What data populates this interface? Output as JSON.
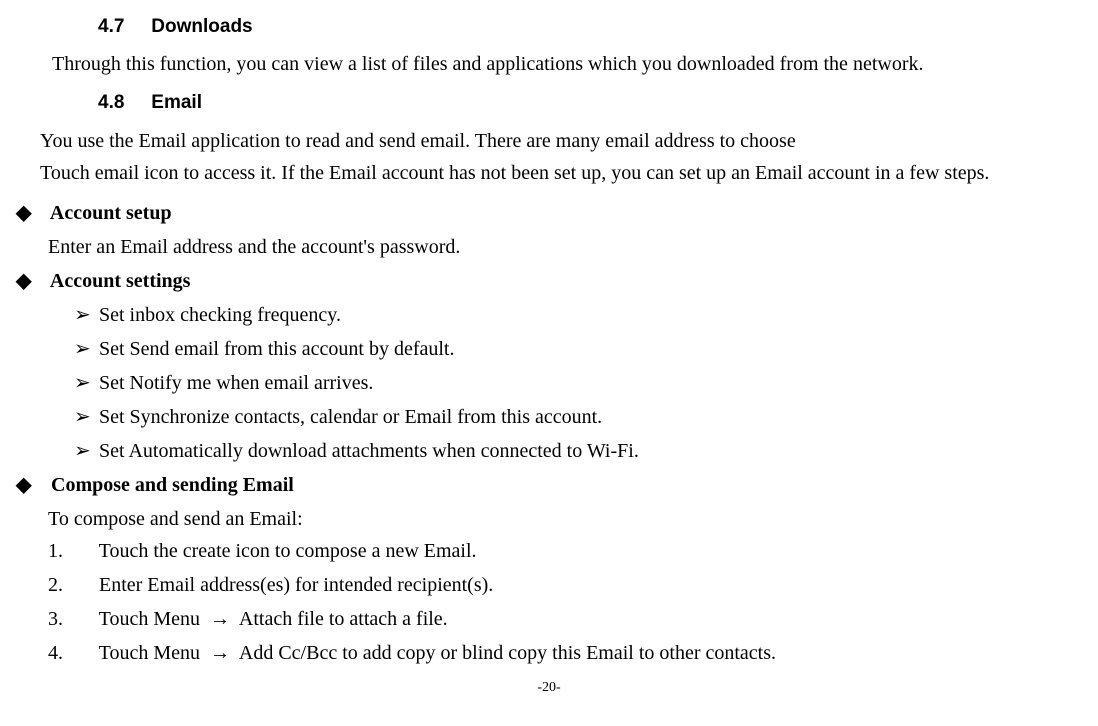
{
  "section47": {
    "number": "4.7",
    "title": "Downloads",
    "paragraph": "Through this function, you can view a list of files and applications which you downloaded from the network."
  },
  "section48": {
    "number": "4.8",
    "title": "Email",
    "intro1": "You use the Email application to read and send email. There are many email address to choose",
    "intro2": "Touch email icon to access it. If the Email account has not been set up, you can set up an Email account in a few steps."
  },
  "accountSetup": {
    "heading": "Account setup",
    "line": "Enter an Email address and the account's password."
  },
  "accountSettings": {
    "heading": "Account settings",
    "items": [
      "Set inbox checking frequency.",
      "Set Send email from this account by default.",
      "Set Notify me when email arrives.",
      "Set Synchronize contacts, calendar or Email from this account.",
      "Set Automatically download attachments when connected to Wi-Fi."
    ]
  },
  "compose": {
    "heading": "Compose and sending Email",
    "intro": "To compose and send an Email:",
    "steps": [
      "Touch the create icon to compose a new Email.",
      "Enter Email address(es) for intended recipient(s).",
      "Touch Menu  →  Attach file to attach a file.",
      "Touch Menu  →  Add Cc/Bcc to add copy or blind copy this Email to other contacts."
    ]
  },
  "pageNumber": "-20-"
}
